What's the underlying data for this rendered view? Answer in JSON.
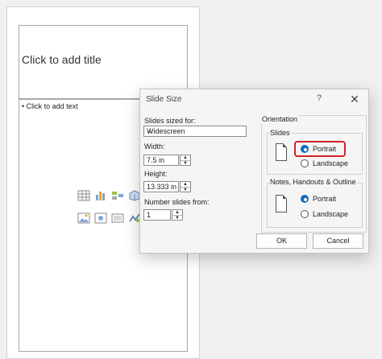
{
  "slide": {
    "title_placeholder": "Click to add title",
    "content_placeholder": "• Click to add text",
    "insert_icons": [
      "table-icon",
      "chart-icon",
      "smartart-icon",
      "3d-model-icon",
      "picture-icon",
      "stock-images-icon",
      "video-icon",
      "icons-icon"
    ]
  },
  "dialog": {
    "title": "Slide Size",
    "help": "?",
    "close": "✕",
    "slides_sized_for_label": "Slides sized for:",
    "slides_sized_for_value": "Widescreen",
    "width_label": "Width:",
    "width_value": "7.5 in",
    "height_label": "Height:",
    "height_value": "13.333 in",
    "number_from_label": "Number slides from:",
    "number_from_value": "1",
    "orientation_label": "Orientation",
    "slides_group_label": "Slides",
    "slides_portrait": "Portrait",
    "slides_landscape": "Landscape",
    "notes_group_label": "Notes, Handouts & Outline",
    "notes_portrait": "Portrait",
    "notes_landscape": "Landscape",
    "ok": "OK",
    "cancel": "Cancel",
    "slides_orientation_selected": "Portrait",
    "notes_orientation_selected": "Portrait"
  },
  "colors": {
    "accent": "#0f6cbd",
    "highlight": "#cf2327"
  }
}
